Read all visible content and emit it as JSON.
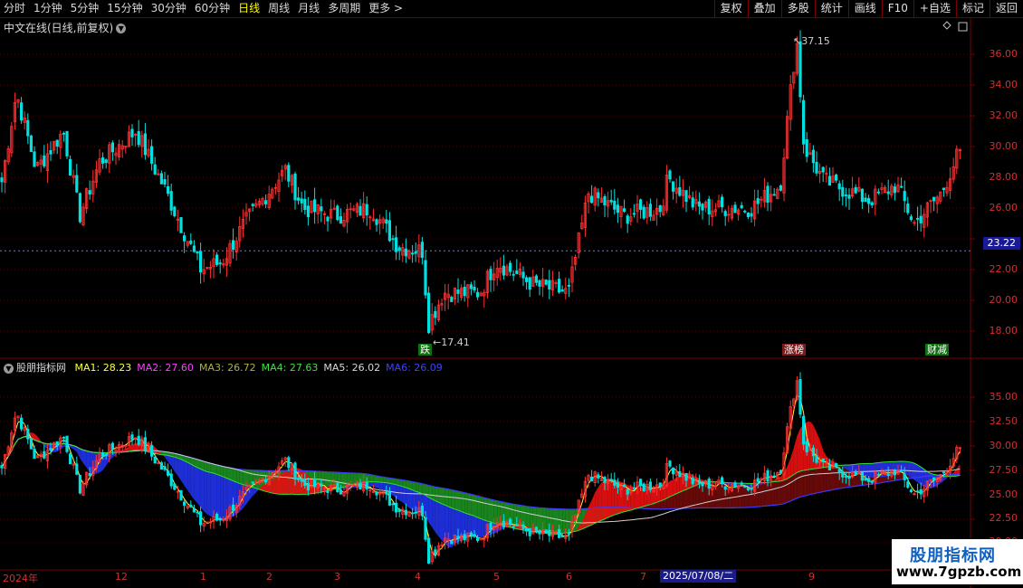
{
  "toolbar": {
    "periods": [
      "分时",
      "1分钟",
      "5分钟",
      "15分钟",
      "30分钟",
      "60分钟",
      "日线",
      "周线",
      "月线",
      "多周期",
      "更多 >"
    ],
    "active": "日线",
    "buttons": [
      "复权",
      "叠加",
      "多股",
      "统计",
      "画线",
      "F10",
      "+自选",
      "标记",
      "返回"
    ]
  },
  "chart": {
    "title": "中文在线(日线,前复权)",
    "high_label": "37.15",
    "low_label": "17.41",
    "last_price": "23.22",
    "price_axis": [
      "36.00",
      "34.00",
      "32.00",
      "30.00",
      "28.00",
      "26.00",
      "24.00",
      "22.00",
      "20.00",
      "18.00"
    ],
    "markers": [
      {
        "text": "跌",
        "bg": "#107010",
        "color": "#ffffff"
      },
      {
        "text": "涨榜",
        "bg": "#7a1a1a",
        "color": "#ffffff"
      },
      {
        "text": "财减",
        "bg": "#107010",
        "color": "#ffffff"
      }
    ]
  },
  "indicator": {
    "title": "股朋指标网",
    "ma": [
      {
        "label": "MA1: 28.23",
        "color": "#ffff40"
      },
      {
        "label": "MA2: 27.60",
        "color": "#ff40ff"
      },
      {
        "label": "MA3: 26.72",
        "color": "#b0b040"
      },
      {
        "label": "MA4: 27.63",
        "color": "#40e040"
      },
      {
        "label": "MA5: 26.02",
        "color": "#d8d8d8"
      },
      {
        "label": "MA6: 26.09",
        "color": "#4040ff"
      }
    ],
    "axis": [
      "35.00",
      "32.50",
      "30.00",
      "27.50",
      "25.00",
      "22.50",
      "20.00"
    ]
  },
  "xaxis": {
    "labels": [
      "2024年",
      "12",
      "1",
      "2",
      "3",
      "4",
      "5",
      "6",
      "7",
      "8",
      "9"
    ],
    "date_badge": "2025/07/08/二"
  },
  "watermark": {
    "cn": "股朋指标网",
    "url": "www.7gpzb.com"
  },
  "colors": {
    "up": "#ff3030",
    "down": "#00e0e0",
    "grid": "#7a0000"
  }
}
